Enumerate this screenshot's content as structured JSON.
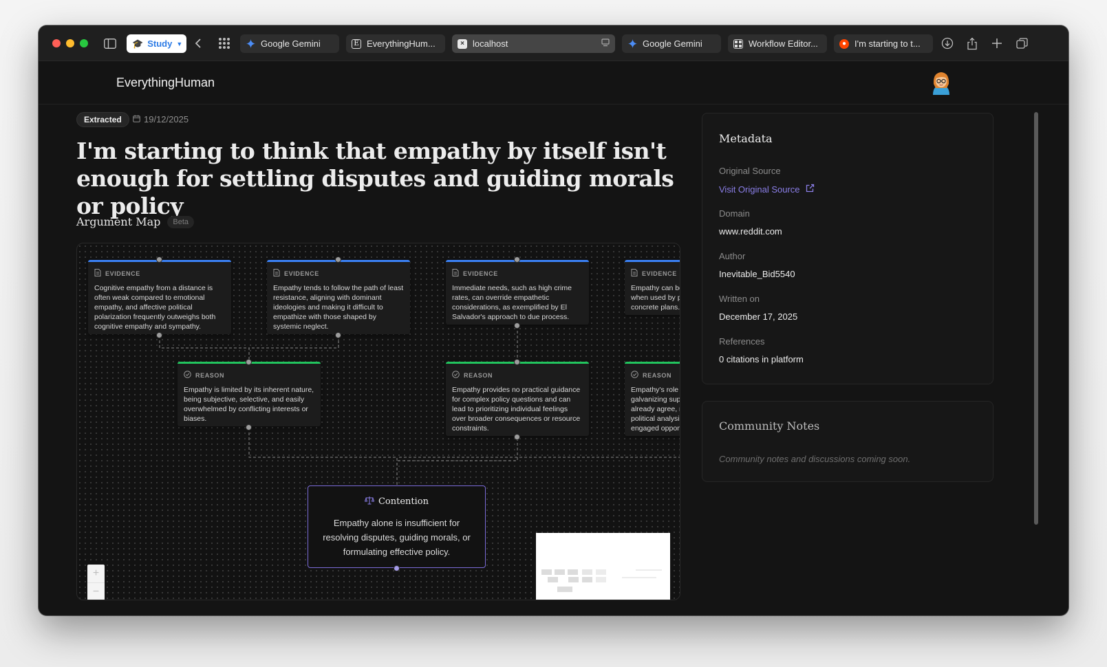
{
  "browser": {
    "study_label": "Study",
    "tabs": [
      {
        "label": "Google Gemini",
        "icon": "gemini-icon"
      },
      {
        "label": "EverythingHum...",
        "icon": "everythinghuman-icon"
      },
      {
        "label": "localhost",
        "icon": "localhost-icon"
      },
      {
        "label": "Google Gemini",
        "icon": "gemini-icon"
      },
      {
        "label": "Workflow Editor...",
        "icon": "workflow-icon"
      },
      {
        "label": "I'm starting to t...",
        "icon": "reddit-icon"
      }
    ]
  },
  "app": {
    "title": "EverythingHuman"
  },
  "article": {
    "status_badge": "Extracted",
    "date": "19/12/2025",
    "title": "I'm starting to think that empathy by itself isn't enough for settling disputes and guiding morals or policy"
  },
  "argument_map": {
    "title": "Argument Map",
    "badge": "Beta",
    "evidence": [
      {
        "label": "EVIDENCE",
        "text": "Cognitive empathy from a distance is often weak compared to emotional empathy, and affective political polarization frequently outweighs both cognitive empathy and sympathy."
      },
      {
        "label": "EVIDENCE",
        "text": "Empathy tends to follow the path of least resistance, aligning with dominant ideologies and making it difficult to empathize with those shaped by systemic neglect."
      },
      {
        "label": "EVIDENCE",
        "text": "Immediate needs, such as high crime rates, can override empathetic considerations, as exemplified by El Salvador's approach to due process."
      },
      {
        "label": "EVIDENCE",
        "text": "Empathy can be when used by p concrete plans."
      }
    ],
    "reasons": [
      {
        "label": "REASON",
        "text": "Empathy is limited by its inherent nature, being subjective, selective, and easily overwhelmed by conflicting interests or biases."
      },
      {
        "label": "REASON",
        "text": "Empathy provides no practical guidance for complex policy questions and can lead to prioritizing individual feelings over broader consequences or resource constraints."
      },
      {
        "label": "REASON",
        "text": "Empathy's role galvanizing sup already agree, r political analysi engaged oppon"
      }
    ],
    "contention": {
      "label": "Contention",
      "text": "Empathy alone is insufficient for resolving disputes, guiding morals, or formulating effective policy."
    }
  },
  "metadata": {
    "title": "Metadata",
    "source_label": "Original Source",
    "source_link": "Visit Original Source",
    "domain_label": "Domain",
    "domain_value": "www.reddit.com",
    "author_label": "Author",
    "author_value": "Inevitable_Bid5540",
    "written_label": "Written on",
    "written_value": "December 17, 2025",
    "references_label": "References",
    "references_value": "0 citations in platform"
  },
  "community_notes": {
    "title": "Community Notes",
    "placeholder": "Community notes and discussions coming soon."
  },
  "colors": {
    "evidence_accent": "#3b82f6",
    "reason_accent": "#22c55e",
    "contention_border": "#7b6cd9",
    "link": "#8b7fe8"
  }
}
